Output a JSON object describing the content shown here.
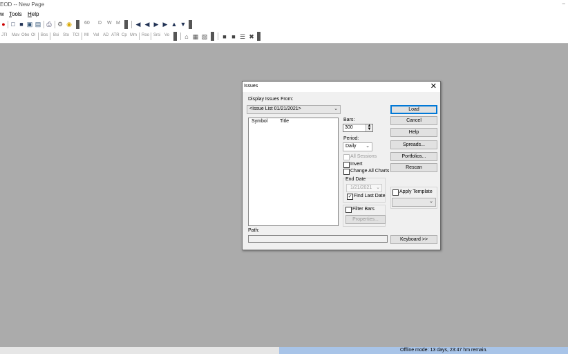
{
  "app": {
    "title": "EOD -- New Page",
    "minimize": "–"
  },
  "menubar": {
    "items": [
      {
        "label": "w"
      },
      {
        "label": "Tools",
        "underline": "T",
        "rest": "ools"
      },
      {
        "label": "Help",
        "underline": "H",
        "rest": "elp"
      }
    ]
  },
  "toolbar1": {
    "period_labels": [
      "60",
      "D",
      "W",
      "M"
    ]
  },
  "toolbar2": {
    "indicators": [
      "JTI",
      "Mav",
      "Obo",
      "Ol",
      "Bos",
      "Bsi",
      "Sto",
      "TCI",
      "MI",
      "Vol",
      "AD",
      "ATR",
      "Cp",
      "Mm",
      "Roo",
      "Srsi",
      "Vo"
    ]
  },
  "statusbar": {
    "offline_text": "Offline mode: 13 days, 23:47 hm remain.",
    "offline_color": "#a8c4e8"
  },
  "dialog": {
    "title": "Issues",
    "close_glyph": "✕",
    "display_from_label": "Display Issues From:",
    "source_value": "<Issue List 01/21/2021>",
    "columns": [
      "Symbol",
      "Title"
    ],
    "bars_label": "Bars:",
    "bars_value": "300",
    "period_label": "Period:",
    "period_value": "Daily",
    "all_sessions_label": "All Sessions",
    "invert_label": "Invert",
    "change_all_label": "Change All Charts",
    "end_date_label": "End Date",
    "end_date_value": "1/21/2021",
    "find_last_date_label": "Find Last Date",
    "filter_bars_label": "Filter Bars",
    "properties_label": "Properties...",
    "apply_template_label": "Apply Template",
    "path_label": "Path:",
    "buttons": {
      "load": "Load",
      "cancel": "Cancel",
      "help": "Help",
      "spreads": "Spreads...",
      "portfolios": "Portfolios...",
      "rescan": "Rescan",
      "keyboard": "Keyboard >>"
    },
    "find_last_date_checked": true,
    "default_button_color": "#0078d7"
  }
}
